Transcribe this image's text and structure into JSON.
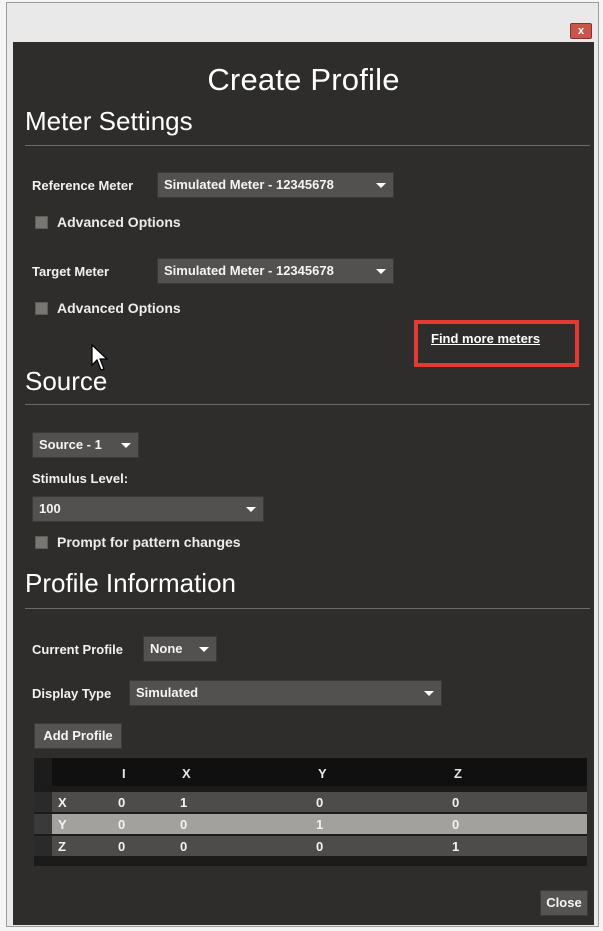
{
  "window": {
    "close_glyph": "x"
  },
  "dialog": {
    "title": "Create Profile"
  },
  "meter_settings": {
    "heading": "Meter Settings",
    "reference_label": "Reference Meter",
    "reference_value": "Simulated Meter - 12345678",
    "reference_advanced": "Advanced Options",
    "target_label": "Target Meter",
    "target_value": "Simulated Meter - 12345678",
    "target_advanced": "Advanced Options",
    "find_more_link": "Find more meters"
  },
  "source": {
    "heading": "Source",
    "source_value": "Source - 1",
    "stimulus_label": "Stimulus Level:",
    "stimulus_value": "100",
    "prompt_label": "Prompt for pattern changes"
  },
  "profile_info": {
    "heading": "Profile Information",
    "current_label": "Current Profile",
    "current_value": "None",
    "display_type_label": "Display Type",
    "display_type_value": "Simulated",
    "add_button": "Add Profile"
  },
  "matrix": {
    "columns": [
      "I",
      "X",
      "Y",
      "Z"
    ],
    "rows": [
      {
        "label": "X",
        "values": [
          "0",
          "1",
          "0",
          "0"
        ]
      },
      {
        "label": "Y",
        "values": [
          "0",
          "0",
          "1",
          "0"
        ]
      },
      {
        "label": "Z",
        "values": [
          "0",
          "0",
          "0",
          "1"
        ]
      }
    ]
  },
  "footer": {
    "close_button": "Close"
  },
  "colors": {
    "panel": "#2e2d2b",
    "highlight": "#e53935",
    "close_window": "#c9554c"
  }
}
